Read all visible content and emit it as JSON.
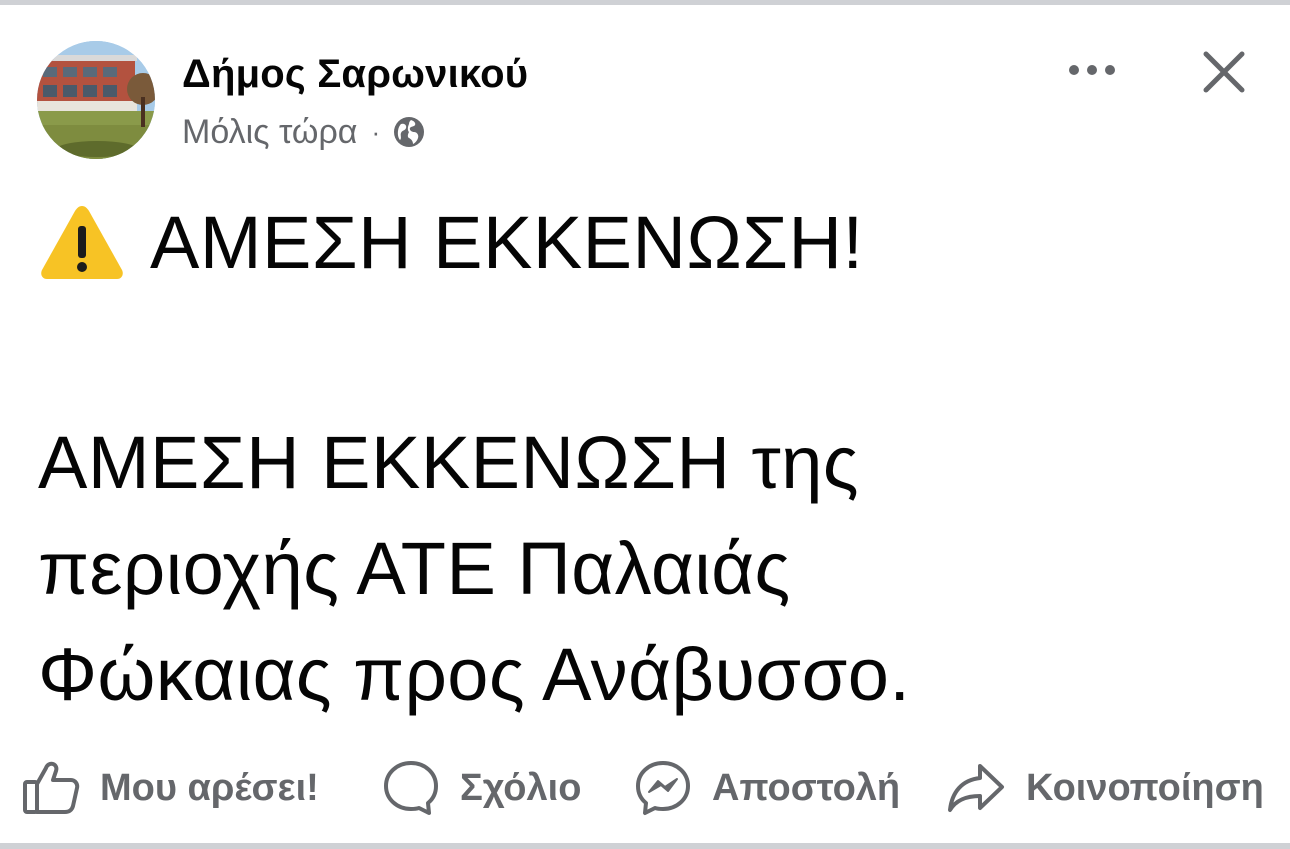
{
  "post": {
    "author": "Δήμος Σαρωνικού",
    "timestamp": "Μόλις τώρα",
    "separator": "·",
    "audience_icon": "globe-icon",
    "headline": "ΑΜΕΣΗ ΕΚΚΕΝΩΣΗ!",
    "headline_icon": "warning-icon",
    "body_lines": [
      "ΑΜΕΣΗ ΕΚΚΕΝΩΣΗ της",
      "περιοχής ΑΤΕ Παλαιάς",
      "Φώκαιας προς Ανάβυσσο."
    ]
  },
  "header_actions": {
    "more_icon": "more-options-icon",
    "close_icon": "close-icon"
  },
  "actions": {
    "like": {
      "label": "Μου αρέσει!",
      "icon": "thumbs-up-icon"
    },
    "comment": {
      "label": "Σχόλιο",
      "icon": "comment-icon"
    },
    "send": {
      "label": "Αποστολή",
      "icon": "messenger-icon"
    },
    "share": {
      "label": "Κοινοποίηση",
      "icon": "share-icon"
    }
  },
  "colors": {
    "text_primary": "#050505",
    "text_secondary": "#65676b",
    "divider": "#cfd1d5",
    "warning_yellow": "#f7c325"
  }
}
